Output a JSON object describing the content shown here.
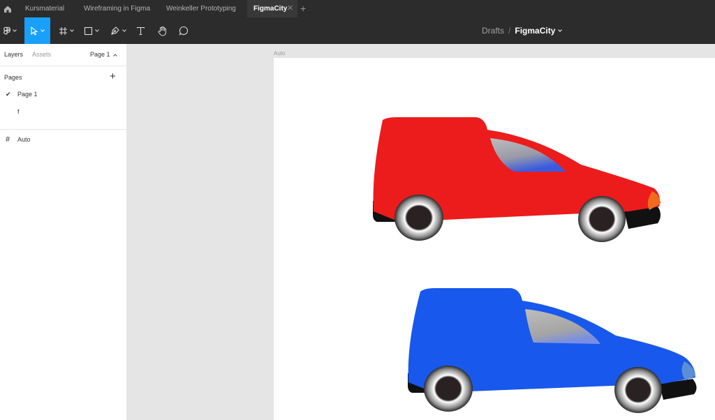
{
  "tabs": [
    {
      "label": "Kursmaterial",
      "active": false
    },
    {
      "label": "Wireframing in Figma",
      "active": false
    },
    {
      "label": "Weinkeller Prototyping",
      "active": false
    },
    {
      "label": "FigmaCity",
      "active": true
    }
  ],
  "toolbar": {
    "tools": [
      "figma-menu",
      "move",
      "frame",
      "shape",
      "pen",
      "text",
      "hand",
      "comment"
    ],
    "active_tool": "move"
  },
  "breadcrumb": {
    "folder": "Drafts",
    "separator": "/",
    "file": "FigmaCity"
  },
  "left_panel": {
    "tab_layers": "Layers",
    "tab_assets": "Assets",
    "current_page": "Page 1",
    "pages_header": "Pages",
    "pages": [
      {
        "label": "Page 1",
        "selected": true
      },
      {
        "label": "f",
        "selected": false
      }
    ],
    "layers": [
      {
        "label": "Auto",
        "type": "frame"
      }
    ]
  },
  "canvas": {
    "frame_label": "Auto",
    "cars": [
      {
        "name": "red-car",
        "body_color": "#ec1c1c",
        "light_color": "#f26a1c"
      },
      {
        "name": "blue-car",
        "body_color": "#1858ec",
        "light_color": "#5a8fd6"
      }
    ]
  },
  "colors": {
    "accent": "#18a0fb",
    "chrome_dark": "#2c2c2c",
    "canvas_bg": "#e5e5e5"
  }
}
